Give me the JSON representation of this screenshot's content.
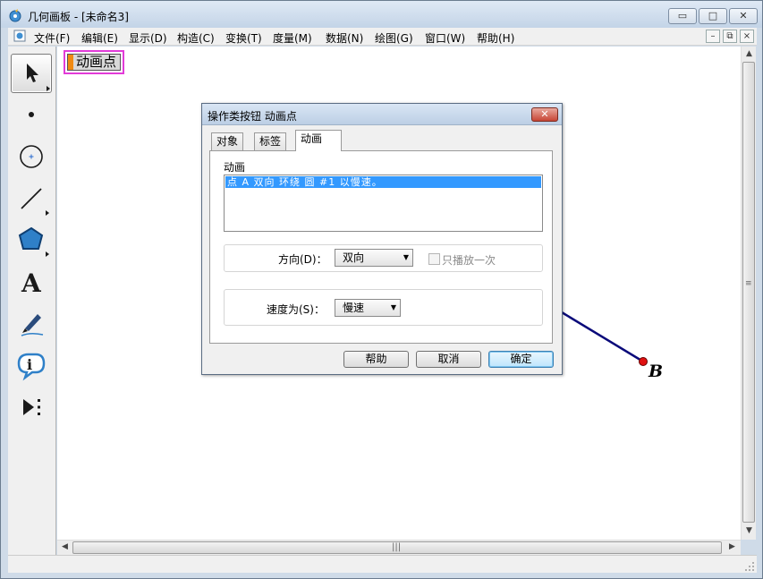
{
  "window": {
    "title": "几何画板 - [未命名3]",
    "buttons": {
      "minimize": "▭",
      "maximize": "□",
      "close": "✕"
    }
  },
  "menu": {
    "items": [
      "文件(F)",
      "编辑(E)",
      "显示(D)",
      "构造(C)",
      "变换(T)",
      "度量(M)",
      "数据(N)",
      "绘图(G)",
      "窗口(W)",
      "帮助(H)"
    ],
    "mdi": {
      "minimize": "–",
      "restore": "⧉",
      "close": "×"
    }
  },
  "toolbox": {
    "tools": [
      "arrow-select-icon",
      "point-icon",
      "compass-icon",
      "straightedge-icon",
      "polygon-icon",
      "text-icon",
      "marker-icon",
      "information-icon",
      "custom-tools-icon"
    ],
    "selected": "arrow-select-icon"
  },
  "canvas": {
    "action_button_label": "动画点",
    "point_label": "B",
    "colors": {
      "segment": "#0a0a7a",
      "point": "#e01010",
      "button_border": "#e23bd8",
      "button_handle": "#f08a12"
    }
  },
  "scrollbars": {
    "up": "▲",
    "down": "▼",
    "left": "◀",
    "right": "▶",
    "grip": "|||"
  },
  "dialog": {
    "title": "操作类按钮 动画点",
    "close": "✕",
    "tabs": [
      "对象",
      "标签",
      "动画"
    ],
    "active_tab": "动画",
    "animation_label": "动画",
    "animation_items": [
      "点 A 双向 环绕 圆 #1 以慢速。"
    ],
    "direction_label": "方向(D)：",
    "direction_value": "双向",
    "play_once_label": "只播放一次",
    "play_once_checked": false,
    "speed_label": "速度为(S)：",
    "speed_value": "慢速",
    "buttons": {
      "help": "帮助",
      "cancel": "取消",
      "ok": "确定"
    }
  }
}
